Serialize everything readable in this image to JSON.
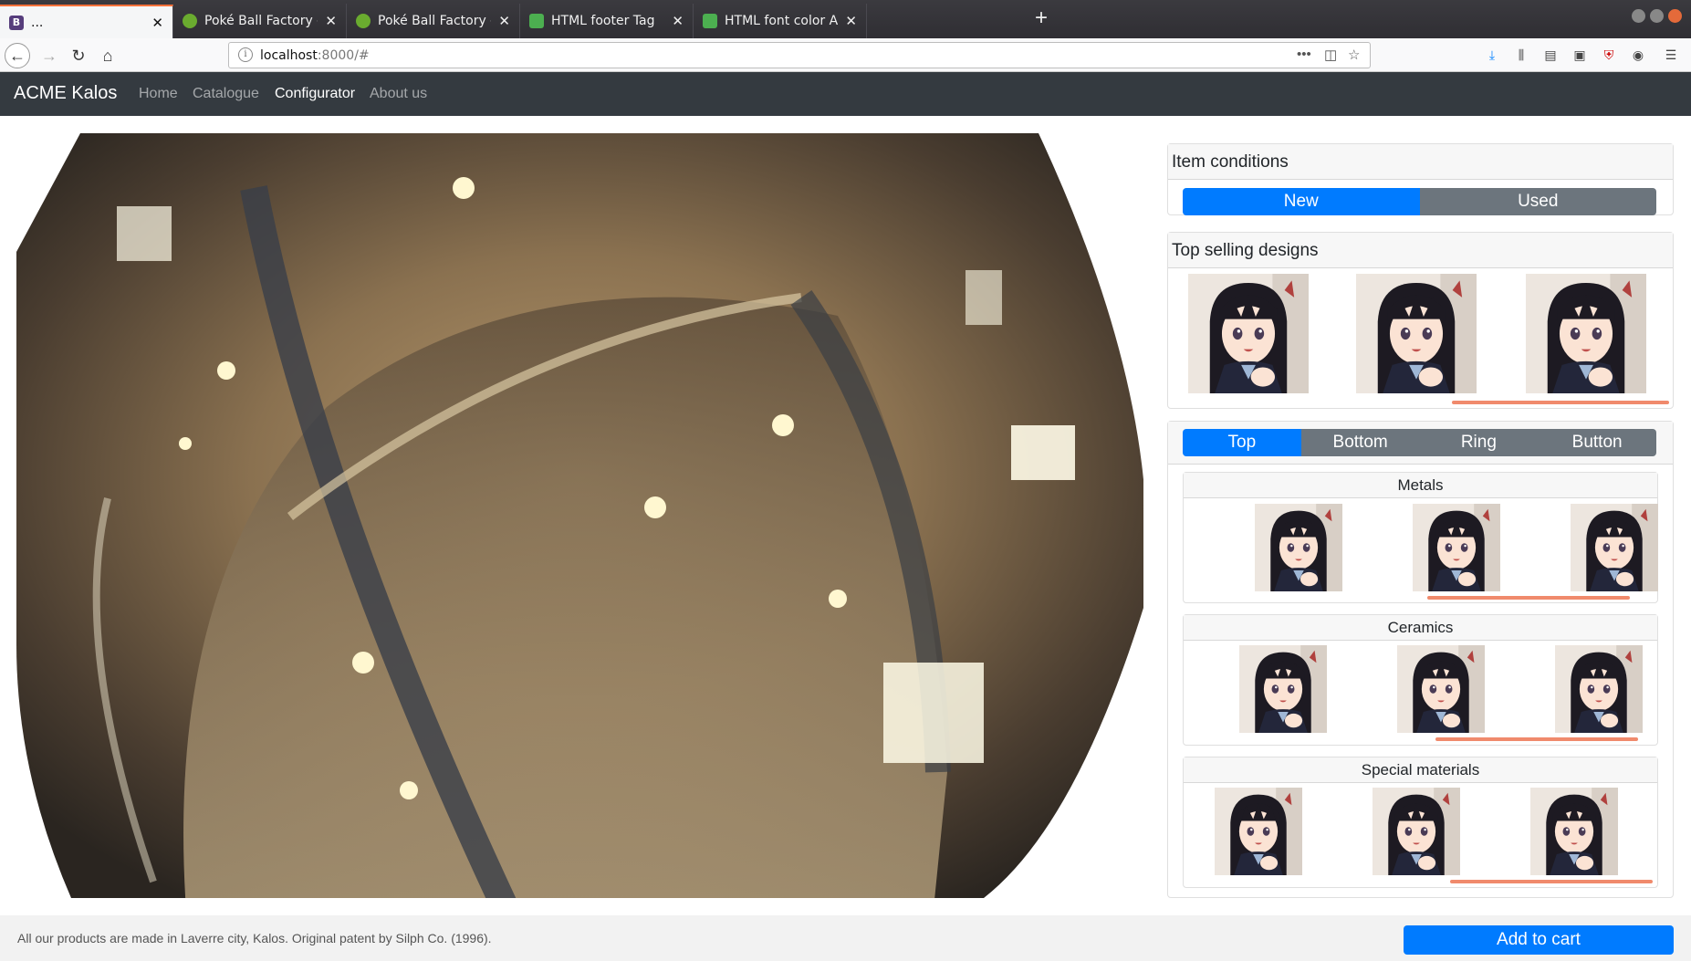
{
  "browser": {
    "tabs": [
      {
        "title": "...",
        "favicon": "B",
        "favicon_color": "#563d7c",
        "active": true
      },
      {
        "title": "Poké Ball Factory - Bulba",
        "favicon": "leaf-icon",
        "favicon_color": "#6aab2f",
        "active": false
      },
      {
        "title": "Poké Ball Factory - Bulba",
        "favicon": "leaf-icon",
        "favicon_color": "#6aab2f",
        "active": false
      },
      {
        "title": "HTML footer Tag",
        "favicon": "w3-icon",
        "favicon_color": "#4caf50",
        "active": false
      },
      {
        "title": "HTML font color Attribu",
        "favicon": "w3-icon",
        "favicon_color": "#4caf50",
        "active": false
      }
    ],
    "url_host": "localhost",
    "url_path": ":8000/#"
  },
  "app": {
    "brand": "ACME Kalos",
    "nav": [
      {
        "label": "Home",
        "active": false
      },
      {
        "label": "Catalogue",
        "active": false
      },
      {
        "label": "Configurator",
        "active": true
      },
      {
        "label": "About us",
        "active": false
      }
    ]
  },
  "panel": {
    "conditions": {
      "title": "Item conditions",
      "options": [
        {
          "label": "New",
          "selected": true
        },
        {
          "label": "Used",
          "selected": false
        }
      ]
    },
    "top_selling": {
      "title": "Top selling designs",
      "scroll_position": 0.55
    },
    "parts": {
      "tabs": [
        {
          "label": "Top",
          "selected": true
        },
        {
          "label": "Bottom",
          "selected": false
        },
        {
          "label": "Ring",
          "selected": false
        },
        {
          "label": "Button",
          "selected": false
        }
      ],
      "categories": [
        {
          "name": "Metals"
        },
        {
          "name": "Ceramics"
        },
        {
          "name": "Special materials"
        }
      ]
    }
  },
  "footer": {
    "note": "All our products are made in Laverre city, Kalos. Original patent by Silph Co. (1996).",
    "cart_label": "Add to cart"
  },
  "colors": {
    "primary": "#007bff",
    "secondary": "#6c757d",
    "dark_nav": "#343a40",
    "scroll_accent": "#f08a6c"
  }
}
